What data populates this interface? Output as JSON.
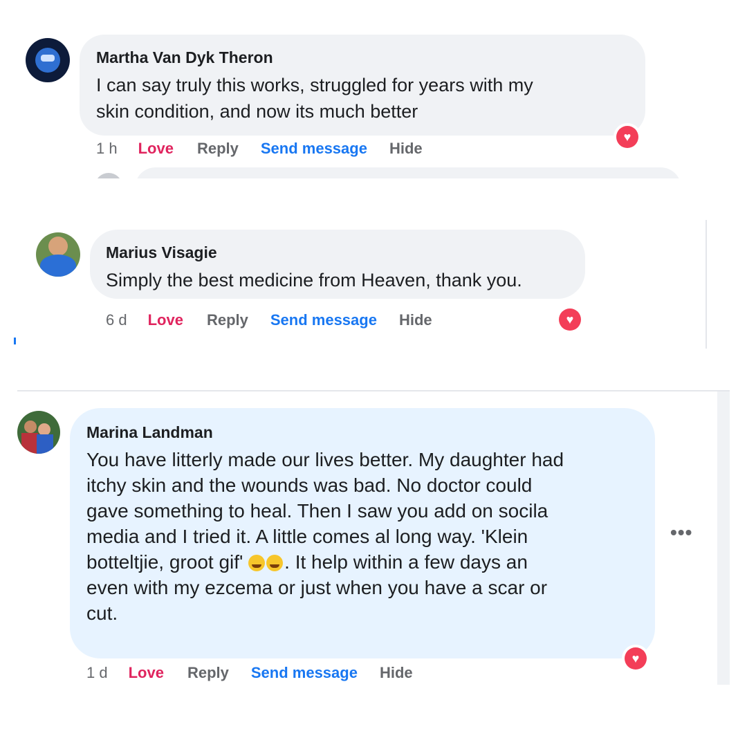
{
  "comments": [
    {
      "author": "Martha Van Dyk Theron",
      "text_lines": [
        "I can say truly this works, struggled for years with my",
        "skin condition, and now its much better"
      ],
      "time": "1 h",
      "actions": {
        "love": "Love",
        "reply": "Reply",
        "send_message": "Send message",
        "hide": "Hide"
      },
      "reaction": "heart-icon"
    },
    {
      "author": "Marius Visagie",
      "text_lines": [
        "Simply the best medicine from Heaven, thank you."
      ],
      "time": "6 d",
      "actions": {
        "love": "Love",
        "reply": "Reply",
        "send_message": "Send message",
        "hide": "Hide"
      },
      "reaction": "heart-icon"
    },
    {
      "author": "Marina Landman",
      "text_lines": [
        "You have litterly made our lives better. My daughter had",
        "itchy skin and the wounds was bad. No doctor could",
        "gave something to heal. Then I saw you add on socila",
        "media and I tried it. A little comes al long way. 'Klein",
        "botteltjie, groot gif' ",
        ". It help within a few days an",
        "even with my ezcema or just when you have a scar or",
        "cut."
      ],
      "time": "1 d",
      "actions": {
        "love": "Love",
        "reply": "Reply",
        "send_message": "Send message",
        "hide": "Hide"
      },
      "reaction": "heart-icon",
      "more": "•••"
    }
  ],
  "colors": {
    "bubble": "#f0f2f5",
    "bubble_highlight": "#e7f3ff",
    "love": "#e0245e",
    "link": "#1877f2",
    "muted": "#65676b",
    "heart": "#f33e58"
  }
}
